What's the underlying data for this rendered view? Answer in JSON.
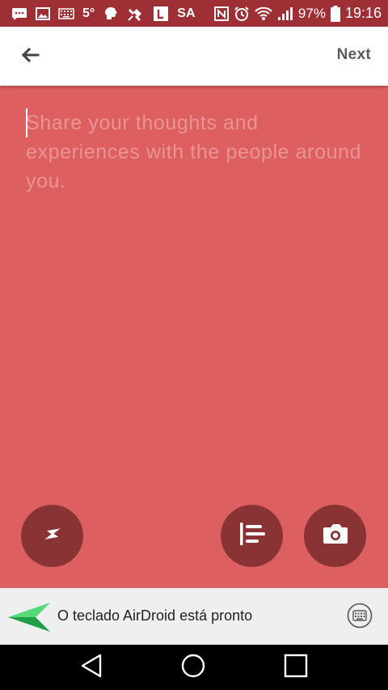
{
  "status_bar": {
    "temperature": "5°",
    "carrier": "SA",
    "battery": "97%",
    "time": "19:16",
    "icons": [
      "message-icon",
      "image-icon",
      "keyboard-icon",
      "weather-icon",
      "brain-icon",
      "satellite-icon",
      "calendar-icon",
      "nfc-icon",
      "alarm-icon",
      "wifi-icon",
      "signal-icon",
      "battery-icon"
    ]
  },
  "top_bar": {
    "back_icon": "arrow-left-icon",
    "next_label": "Next"
  },
  "compose": {
    "placeholder": "Share your thoughts and experiences with the people around you.",
    "background": "#de5f60"
  },
  "actions": {
    "icons": [
      "flash-icon",
      "align-left-icon",
      "camera-icon"
    ],
    "button_color": "#8a3335"
  },
  "keyboard_notice": {
    "text": "O teclado AirDroid está pronto",
    "logo": "airdroid-logo",
    "icon": "keyboard-icon"
  },
  "nav_bar": {
    "icons": [
      "back-triangle-icon",
      "home-circle-icon",
      "recents-square-icon"
    ]
  }
}
